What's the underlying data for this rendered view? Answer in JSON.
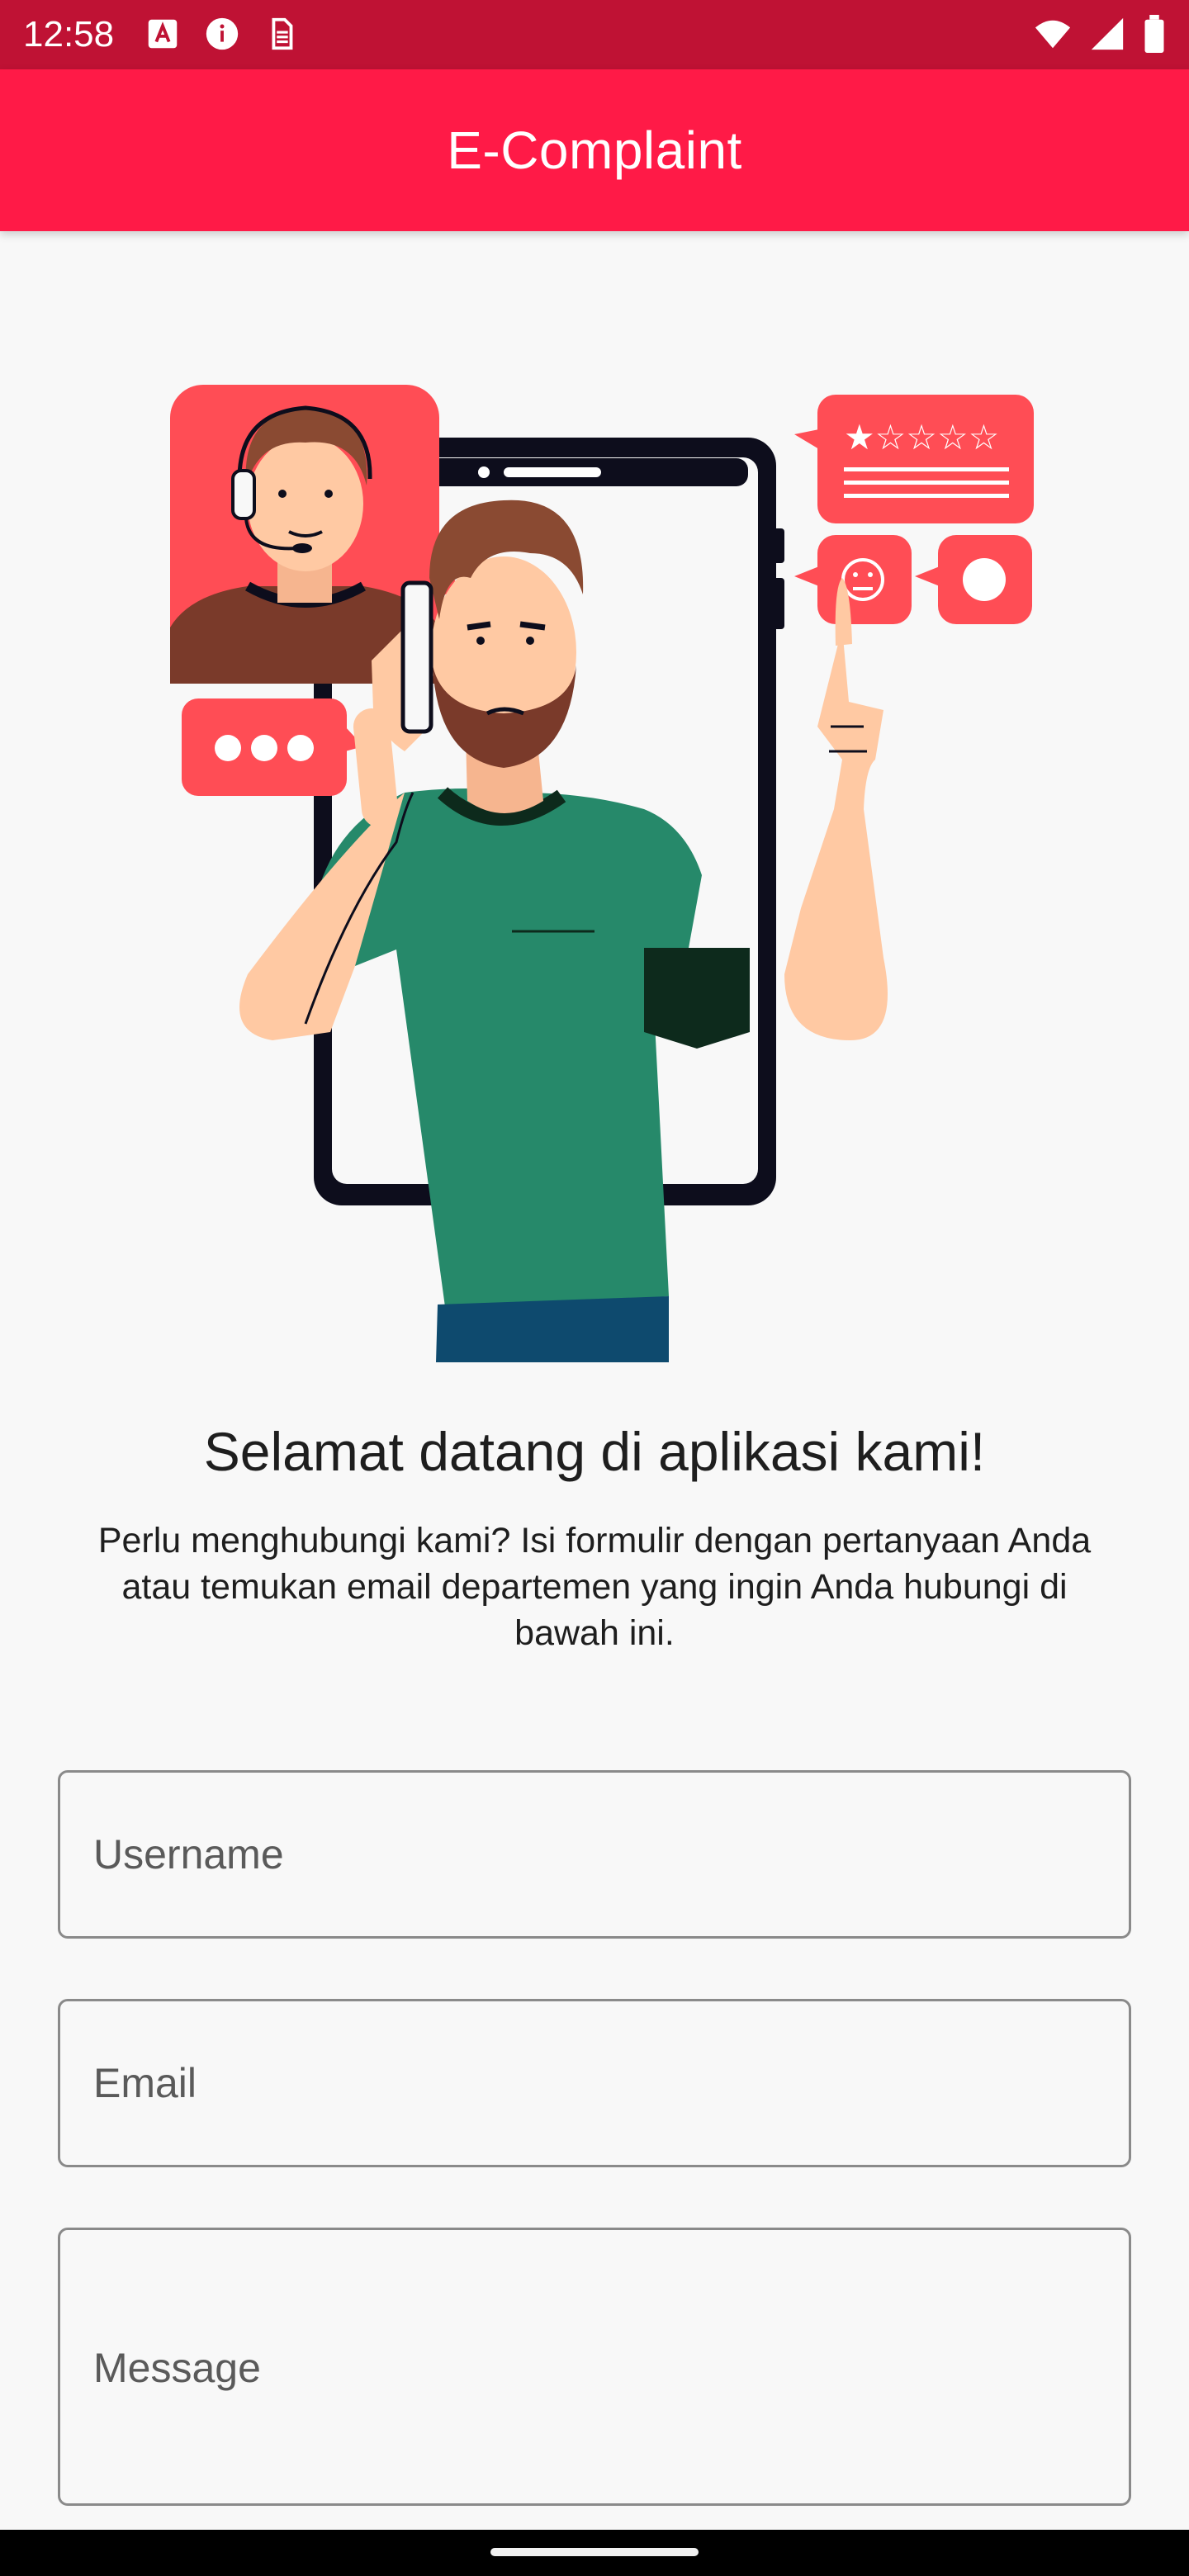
{
  "status_bar": {
    "time": "12:58",
    "left_icons": [
      "text-format-icon",
      "info-icon",
      "sim-icon"
    ],
    "right_icons": [
      "wifi-icon",
      "signal-icon",
      "battery-icon"
    ]
  },
  "app_bar": {
    "title": "E-Complaint",
    "color": "#ff1a47"
  },
  "hero": {
    "illustration": "customer-support-illustration"
  },
  "welcome": {
    "title": "Selamat datang di aplikasi kami!",
    "description": "Perlu menghubungi kami? Isi formulir dengan pertanyaan Anda atau temukan email departemen yang ingin Anda hubungi di bawah ini."
  },
  "form": {
    "username_placeholder": "Username",
    "email_placeholder": "Email",
    "message_placeholder": "Message"
  },
  "colors": {
    "status_bar": "#bf1234",
    "accent": "#ff1a47",
    "background": "#f8f8f8"
  }
}
